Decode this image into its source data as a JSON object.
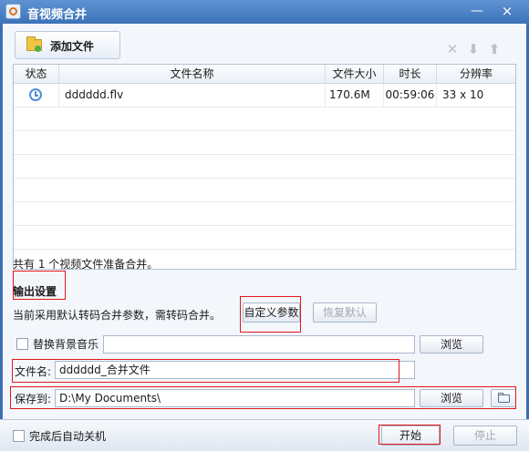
{
  "window": {
    "title": "音视频合并",
    "minimize": "—",
    "close": "×"
  },
  "toolbar": {
    "add_label": "添加文件",
    "delete_icon": "✕",
    "down_icon": "⬇",
    "up_icon": "⬆"
  },
  "table": {
    "columns": [
      "状态",
      "文件名称",
      "文件大小",
      "时长",
      "分辨率"
    ],
    "rows": [
      {
        "name": "dddddd.flv",
        "size": "170.6M",
        "duration": "00:59:06",
        "resolution": "33 x 10"
      }
    ]
  },
  "summary": "共有 1 个视频文件准备合并。",
  "output": {
    "section_title": "输出设置",
    "hint": "当前采用默认转码合并参数，需转码合并。",
    "custom_label": "自定义参数",
    "restore_label": "恢复默认",
    "music_label": "替换背景音乐",
    "music_value": "",
    "browse_label": "浏览",
    "filename_label": "文件名:",
    "filename_value": "dddddd_合并文件",
    "saveto_label": "保存到:",
    "saveto_value": "D:\\My Documents\\"
  },
  "footer": {
    "shutdown_label": "完成后自动关机",
    "start_label": "开始",
    "stop_label": "停止"
  },
  "colors": {
    "accent": "#3b6fb3",
    "highlight": "#e5161c"
  }
}
